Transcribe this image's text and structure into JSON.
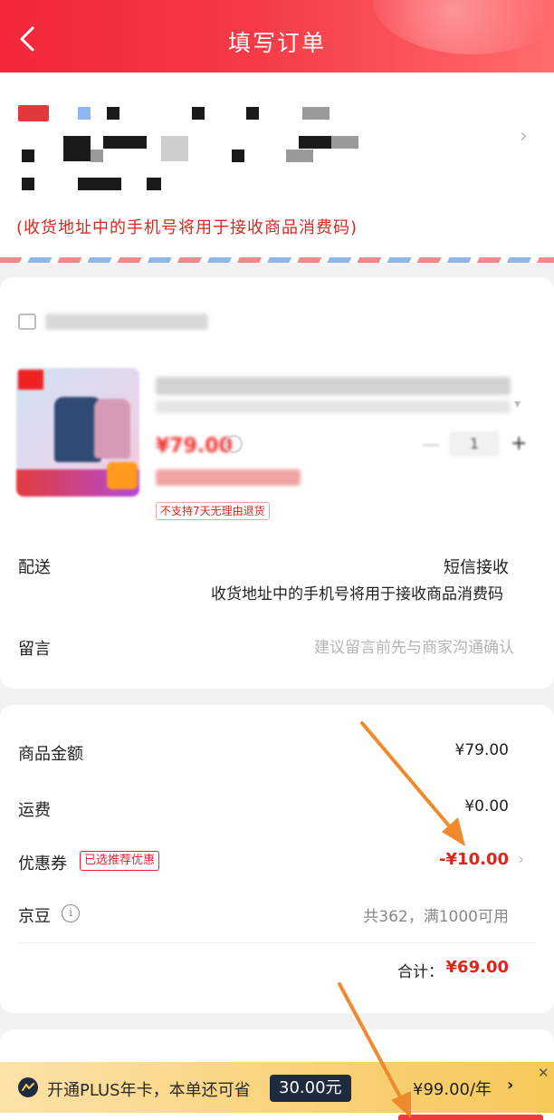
{
  "header": {
    "title": "填写订单"
  },
  "address": {
    "note": "(收货地址中的手机号将用于接收商品消费码)"
  },
  "product": {
    "price": "¥79.00",
    "quantity": "1",
    "return_policy": "不支持7天无理由退货"
  },
  "delivery": {
    "label": "配送",
    "value": "短信接收",
    "note": "收货地址中的手机号将用于接收商品消费码"
  },
  "message": {
    "label": "留言",
    "placeholder": "建议留言前先与商家沟通确认"
  },
  "summary": {
    "goods_amount_label": "商品金额",
    "goods_amount_value": "¥79.00",
    "shipping_label": "运费",
    "shipping_value": "¥0.00",
    "coupon_label": "优惠券",
    "coupon_badge": "已选推荐优惠",
    "coupon_value": "-¥10.00",
    "beans_label": "京豆",
    "beans_value": "共362，满1000可用",
    "total_label": "合计：",
    "total_value": "¥69.00"
  },
  "plus_banner": {
    "text": "开通PLUS年卡，本单还可省",
    "save_amount": "30.00元",
    "price": "¥99.00/年"
  },
  "colors": {
    "brand_red": "#e2231a",
    "header_red": "#f2273a",
    "annotation_orange": "#f08a2c"
  }
}
